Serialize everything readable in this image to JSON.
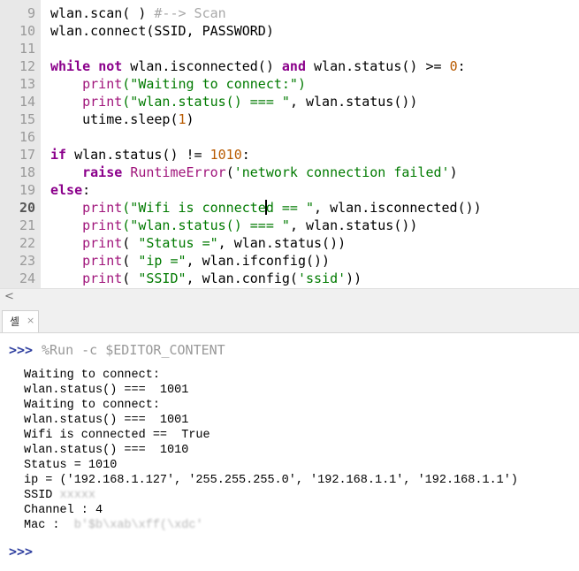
{
  "editor": {
    "line_numbers": [
      "9",
      "10",
      "11",
      "12",
      "13",
      "14",
      "15",
      "16",
      "17",
      "18",
      "19",
      "20",
      "21",
      "22",
      "23",
      "24"
    ],
    "current_line": "20",
    "l9": {
      "a": "wlan.scan( ) ",
      "b": "#--> Scan"
    },
    "l10": {
      "a": "wlan.connect(SSID, PASSWORD)"
    },
    "l12": {
      "a": "while",
      "b": " ",
      "c": "not",
      "d": " wlan.isconnected() ",
      "e": "and",
      "f": " wlan.status() >= ",
      "g": "0",
      "h": ":"
    },
    "l13": {
      "a": "    ",
      "b": "print",
      "c": "(\"Waiting to connect:\")"
    },
    "l14": {
      "a": "    ",
      "b": "print",
      "c": "(\"wlan.status() === \"",
      "d": ", wlan.status())"
    },
    "l15": {
      "a": "    utime.sleep(",
      "b": "1",
      "c": ")"
    },
    "l17": {
      "a": "if",
      "b": " wlan.status() != ",
      "c": "1010",
      "d": ":"
    },
    "l18": {
      "a": "    ",
      "b": "raise",
      "c": " ",
      "d": "RuntimeError",
      "e": "(",
      "f": "'network connection failed'",
      "g": ")"
    },
    "l19": {
      "a": "else",
      "b": ":"
    },
    "l20": {
      "a": "    ",
      "b": "print",
      "c": "(\"Wifi is connecte",
      "d": "d == \"",
      "e": ", wlan.isconnected())"
    },
    "l21": {
      "a": "    ",
      "b": "print",
      "c": "(\"wlan.status() === \"",
      "d": ", wlan.status())"
    },
    "l22": {
      "a": "    ",
      "b": "print",
      "c": "( ",
      "d": "\"Status =\"",
      "e": ", wlan.status())"
    },
    "l23": {
      "a": "    ",
      "b": "print",
      "c": "( ",
      "d": "\"ip =\"",
      "e": ", wlan.ifconfig())"
    },
    "l24": {
      "a": "    ",
      "b": "print",
      "c": "( ",
      "d": "\"SSID\"",
      "e": ", wlan.config(",
      "f": "'ssid'",
      "g": "))"
    }
  },
  "scrollbar": {
    "left_arrow": "<",
    "right_arrow": ">"
  },
  "shell_tab": {
    "label": "셸",
    "close": "×"
  },
  "shell": {
    "prompt": ">>>",
    "command": "%Run -c $EDITOR_CONTENT",
    "output": [
      "Waiting to connect:",
      "wlan.status() ===  1001",
      "Waiting to connect:",
      "wlan.status() ===  1001",
      "Wifi is connected ==  True",
      "wlan.status() ===  1010",
      "Status = 1010",
      "ip = ('192.168.1.127', '255.255.255.0', '192.168.1.1', '192.168.1.1')"
    ],
    "ssid_label": "SSID ",
    "ssid_value_redacted": "xxxxx",
    "channel_line": "Channel : 4",
    "mac_label": "Mac :  ",
    "mac_value_redacted": "b'$b\\xab\\xff(\\xdc'",
    "end_prompt": ">>>"
  },
  "colors": {
    "keyword": "#8b008b",
    "string": "#007a00",
    "number": "#b85a00",
    "builtin": "#a0157b",
    "prompt": "#3040a0"
  }
}
